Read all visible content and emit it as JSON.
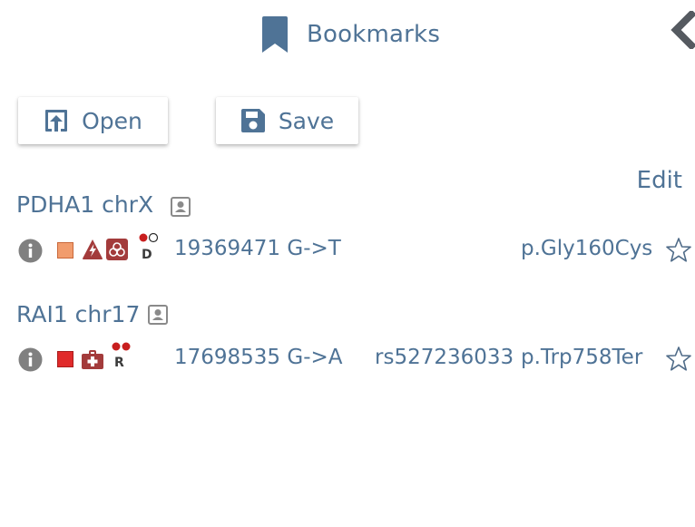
{
  "header": {
    "title": "Bookmarks",
    "title_icon": "bookmark-icon",
    "back_icon": "chevron-left-icon"
  },
  "toolbar": {
    "open_label": "Open",
    "open_icon": "open-upload-icon",
    "save_label": "Save",
    "save_icon": "floppy-disk-icon",
    "edit_label": "Edit"
  },
  "colors": {
    "text": "#4f7396",
    "icon_gray": "#808080",
    "dark_red": "#a33b3b",
    "salmon": "#f19c6d",
    "red": "#e02a2a"
  },
  "bookmarks": [
    {
      "title": "PDHA1 chrX",
      "position": "19369471 G->T",
      "rsid": "",
      "protein": "p.Gly160Cys",
      "zygosity_letter": "D",
      "badges": [
        "info-icon",
        "salmon-square-icon",
        "warning-triangle-icon",
        "biohazard-icon",
        "zygosity-icon",
        "star-outline-icon"
      ]
    },
    {
      "title": "RAI1 chr17",
      "position": "17698535 G->A",
      "rsid": "rs527236033",
      "protein": "p.Trp758Ter",
      "zygosity_letter": "R",
      "badges": [
        "info-icon",
        "red-square-icon",
        "medical-kit-icon",
        "zygosity-icon",
        "star-outline-icon"
      ]
    }
  ]
}
